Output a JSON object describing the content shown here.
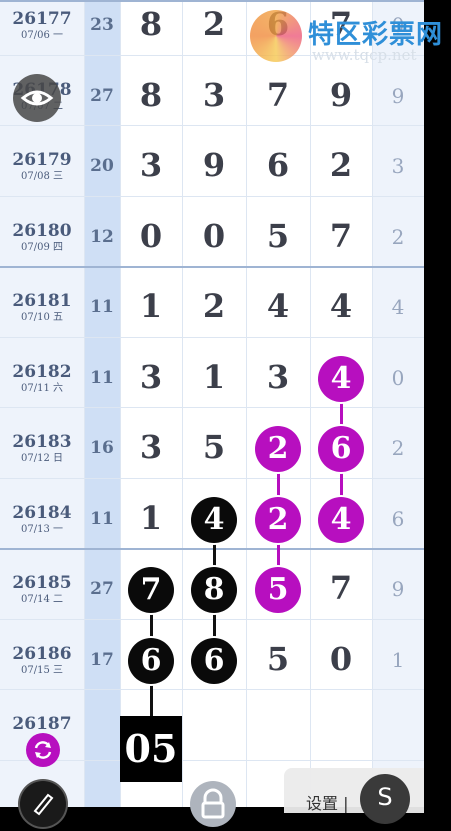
{
  "logo": {
    "title": "特区彩票网",
    "url": "www.tqcp.net"
  },
  "rows": [
    {
      "issue": "26177",
      "date": "07/06 一",
      "sum": "23",
      "digits": [
        "8",
        "2",
        "6",
        "7"
      ],
      "end": "0"
    },
    {
      "issue": "26178",
      "date": "07/07 二",
      "sum": "27",
      "digits": [
        "8",
        "3",
        "7",
        "9"
      ],
      "end": "9"
    },
    {
      "issue": "26179",
      "date": "07/08 三",
      "sum": "20",
      "digits": [
        "3",
        "9",
        "6",
        "2"
      ],
      "end": "3"
    },
    {
      "issue": "26180",
      "date": "07/09 四",
      "sum": "12",
      "digits": [
        "0",
        "0",
        "5",
        "7"
      ],
      "end": "2"
    },
    {
      "issue": "26181",
      "date": "07/10 五",
      "sum": "11",
      "digits": [
        "1",
        "2",
        "4",
        "4"
      ],
      "end": "4"
    },
    {
      "issue": "26182",
      "date": "07/11 六",
      "sum": "11",
      "digits": [
        "3",
        "1",
        "3",
        "4"
      ],
      "end": "0"
    },
    {
      "issue": "26183",
      "date": "07/12 日",
      "sum": "16",
      "digits": [
        "3",
        "5",
        "2",
        "6"
      ],
      "end": "2"
    },
    {
      "issue": "26184",
      "date": "07/13 一",
      "sum": "11",
      "digits": [
        "1",
        "4",
        "2",
        "4"
      ],
      "end": "6"
    },
    {
      "issue": "26185",
      "date": "07/14 二",
      "sum": "27",
      "digits": [
        "7",
        "8",
        "5",
        "7"
      ],
      "end": "9"
    },
    {
      "issue": "26186",
      "date": "07/15 三",
      "sum": "17",
      "digits": [
        "6",
        "6",
        "5",
        "0"
      ],
      "end": "1"
    }
  ],
  "partial_row": {
    "issue": "26187",
    "current": "05"
  },
  "settings": {
    "label": "设置 |",
    "shortcut": "S"
  },
  "colors": {
    "highlight_black": "#0a0a0a",
    "highlight_magenta": "#b70fbf",
    "sum_col": "#cfdff5"
  },
  "icons": {
    "eye": "eye-icon",
    "refresh": "refresh-icon",
    "pen": "pen-icon",
    "lock": "lock-icon"
  }
}
